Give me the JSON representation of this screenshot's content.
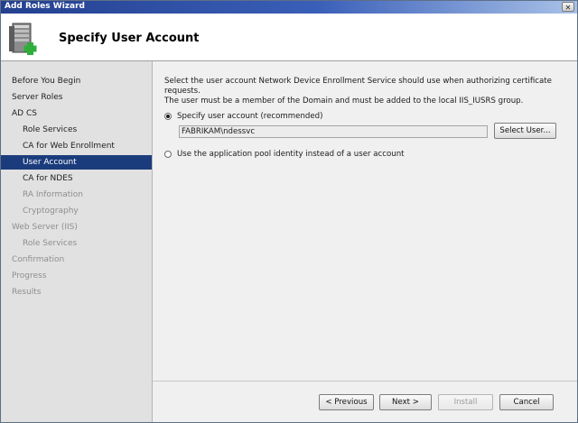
{
  "window": {
    "title": "Add Roles Wizard",
    "close_glyph": "✕"
  },
  "header": {
    "title": "Specify User Account",
    "icon": "server-roles-add-icon"
  },
  "sidebar": {
    "items": [
      {
        "label": "Before You Begin",
        "state": "normal"
      },
      {
        "label": "Server Roles",
        "state": "normal"
      },
      {
        "label": "AD CS",
        "state": "normal"
      },
      {
        "label": "Role Services",
        "state": "normal"
      },
      {
        "label": "CA for Web Enrollment",
        "state": "normal"
      },
      {
        "label": "User Account",
        "state": "selected"
      },
      {
        "label": "CA for NDES",
        "state": "normal"
      },
      {
        "label": "RA Information",
        "state": "disabled"
      },
      {
        "label": "Cryptography",
        "state": "disabled"
      },
      {
        "label": "Web Server (IIS)",
        "state": "disabled"
      },
      {
        "label": "Role Services",
        "state": "disabled"
      },
      {
        "label": "Confirmation",
        "state": "disabled"
      },
      {
        "label": "Progress",
        "state": "disabled"
      },
      {
        "label": "Results",
        "state": "disabled"
      }
    ]
  },
  "main": {
    "description_line1": "Select the user account Network Device Enrollment Service should use when authorizing certificate requests.",
    "description_line2": "The user must be a member of the Domain and must be added to the local IIS_IUSRS group.",
    "option_specify_label": "Specify user account (recommended)",
    "option_specify_selected": true,
    "user_account_value": "FABRIKAM\\ndessvc",
    "select_user_label": "Select User...",
    "option_apppool_label": "Use the application pool identity instead of a user account",
    "option_apppool_selected": false
  },
  "footer": {
    "previous_label": "< Previous",
    "next_label": "Next >",
    "install_label": "Install",
    "cancel_label": "Cancel"
  },
  "colors": {
    "selected_nav_bg": "#1b3c7c",
    "titlebar_start": "#24408f"
  }
}
